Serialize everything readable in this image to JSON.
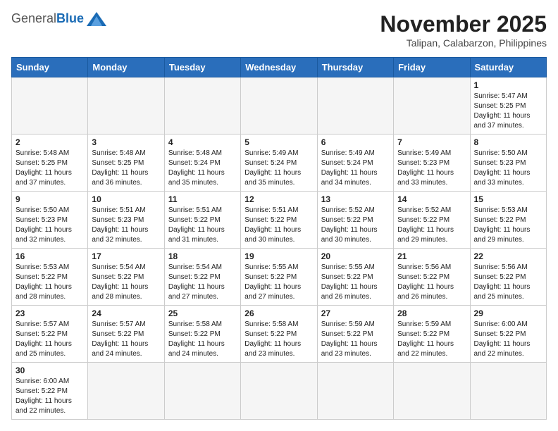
{
  "header": {
    "logo_general": "General",
    "logo_blue": "Blue",
    "month_title": "November 2025",
    "location": "Talipan, Calabarzon, Philippines"
  },
  "weekdays": [
    "Sunday",
    "Monday",
    "Tuesday",
    "Wednesday",
    "Thursday",
    "Friday",
    "Saturday"
  ],
  "weeks": [
    [
      {
        "day": "",
        "info": ""
      },
      {
        "day": "",
        "info": ""
      },
      {
        "day": "",
        "info": ""
      },
      {
        "day": "",
        "info": ""
      },
      {
        "day": "",
        "info": ""
      },
      {
        "day": "",
        "info": ""
      },
      {
        "day": "1",
        "info": "Sunrise: 5:47 AM\nSunset: 5:25 PM\nDaylight: 11 hours\nand 37 minutes."
      }
    ],
    [
      {
        "day": "2",
        "info": "Sunrise: 5:48 AM\nSunset: 5:25 PM\nDaylight: 11 hours\nand 37 minutes."
      },
      {
        "day": "3",
        "info": "Sunrise: 5:48 AM\nSunset: 5:25 PM\nDaylight: 11 hours\nand 36 minutes."
      },
      {
        "day": "4",
        "info": "Sunrise: 5:48 AM\nSunset: 5:24 PM\nDaylight: 11 hours\nand 35 minutes."
      },
      {
        "day": "5",
        "info": "Sunrise: 5:49 AM\nSunset: 5:24 PM\nDaylight: 11 hours\nand 35 minutes."
      },
      {
        "day": "6",
        "info": "Sunrise: 5:49 AM\nSunset: 5:24 PM\nDaylight: 11 hours\nand 34 minutes."
      },
      {
        "day": "7",
        "info": "Sunrise: 5:49 AM\nSunset: 5:23 PM\nDaylight: 11 hours\nand 33 minutes."
      },
      {
        "day": "8",
        "info": "Sunrise: 5:50 AM\nSunset: 5:23 PM\nDaylight: 11 hours\nand 33 minutes."
      }
    ],
    [
      {
        "day": "9",
        "info": "Sunrise: 5:50 AM\nSunset: 5:23 PM\nDaylight: 11 hours\nand 32 minutes."
      },
      {
        "day": "10",
        "info": "Sunrise: 5:51 AM\nSunset: 5:23 PM\nDaylight: 11 hours\nand 32 minutes."
      },
      {
        "day": "11",
        "info": "Sunrise: 5:51 AM\nSunset: 5:22 PM\nDaylight: 11 hours\nand 31 minutes."
      },
      {
        "day": "12",
        "info": "Sunrise: 5:51 AM\nSunset: 5:22 PM\nDaylight: 11 hours\nand 30 minutes."
      },
      {
        "day": "13",
        "info": "Sunrise: 5:52 AM\nSunset: 5:22 PM\nDaylight: 11 hours\nand 30 minutes."
      },
      {
        "day": "14",
        "info": "Sunrise: 5:52 AM\nSunset: 5:22 PM\nDaylight: 11 hours\nand 29 minutes."
      },
      {
        "day": "15",
        "info": "Sunrise: 5:53 AM\nSunset: 5:22 PM\nDaylight: 11 hours\nand 29 minutes."
      }
    ],
    [
      {
        "day": "16",
        "info": "Sunrise: 5:53 AM\nSunset: 5:22 PM\nDaylight: 11 hours\nand 28 minutes."
      },
      {
        "day": "17",
        "info": "Sunrise: 5:54 AM\nSunset: 5:22 PM\nDaylight: 11 hours\nand 28 minutes."
      },
      {
        "day": "18",
        "info": "Sunrise: 5:54 AM\nSunset: 5:22 PM\nDaylight: 11 hours\nand 27 minutes."
      },
      {
        "day": "19",
        "info": "Sunrise: 5:55 AM\nSunset: 5:22 PM\nDaylight: 11 hours\nand 27 minutes."
      },
      {
        "day": "20",
        "info": "Sunrise: 5:55 AM\nSunset: 5:22 PM\nDaylight: 11 hours\nand 26 minutes."
      },
      {
        "day": "21",
        "info": "Sunrise: 5:56 AM\nSunset: 5:22 PM\nDaylight: 11 hours\nand 26 minutes."
      },
      {
        "day": "22",
        "info": "Sunrise: 5:56 AM\nSunset: 5:22 PM\nDaylight: 11 hours\nand 25 minutes."
      }
    ],
    [
      {
        "day": "23",
        "info": "Sunrise: 5:57 AM\nSunset: 5:22 PM\nDaylight: 11 hours\nand 25 minutes."
      },
      {
        "day": "24",
        "info": "Sunrise: 5:57 AM\nSunset: 5:22 PM\nDaylight: 11 hours\nand 24 minutes."
      },
      {
        "day": "25",
        "info": "Sunrise: 5:58 AM\nSunset: 5:22 PM\nDaylight: 11 hours\nand 24 minutes."
      },
      {
        "day": "26",
        "info": "Sunrise: 5:58 AM\nSunset: 5:22 PM\nDaylight: 11 hours\nand 23 minutes."
      },
      {
        "day": "27",
        "info": "Sunrise: 5:59 AM\nSunset: 5:22 PM\nDaylight: 11 hours\nand 23 minutes."
      },
      {
        "day": "28",
        "info": "Sunrise: 5:59 AM\nSunset: 5:22 PM\nDaylight: 11 hours\nand 22 minutes."
      },
      {
        "day": "29",
        "info": "Sunrise: 6:00 AM\nSunset: 5:22 PM\nDaylight: 11 hours\nand 22 minutes."
      }
    ],
    [
      {
        "day": "30",
        "info": "Sunrise: 6:00 AM\nSunset: 5:22 PM\nDaylight: 11 hours\nand 22 minutes."
      },
      {
        "day": "",
        "info": ""
      },
      {
        "day": "",
        "info": ""
      },
      {
        "day": "",
        "info": ""
      },
      {
        "day": "",
        "info": ""
      },
      {
        "day": "",
        "info": ""
      },
      {
        "day": "",
        "info": ""
      }
    ]
  ]
}
